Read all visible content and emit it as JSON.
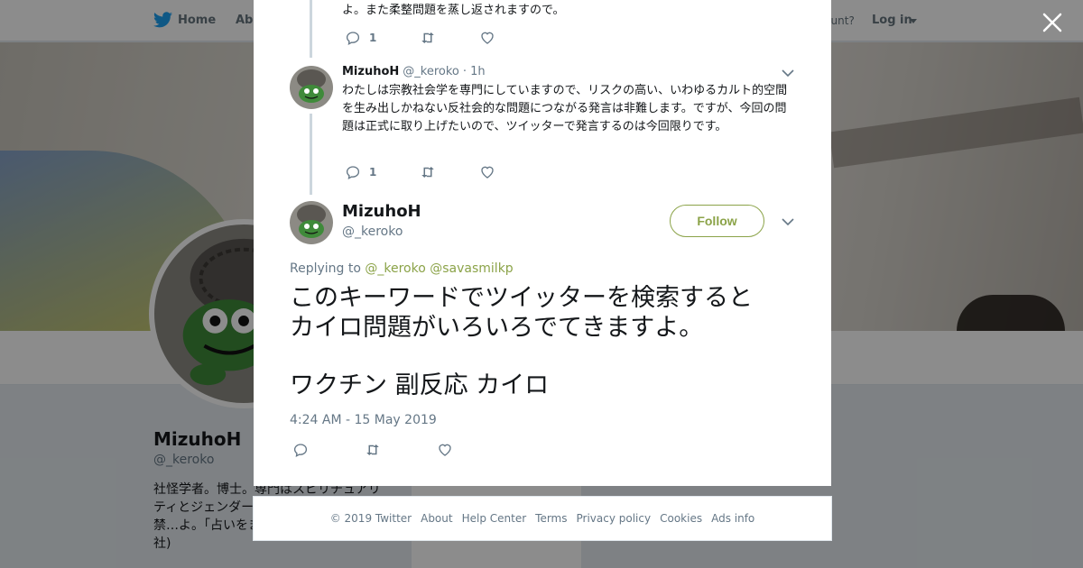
{
  "topbar": {
    "home_label": "Home",
    "about_label": "Abo",
    "account_prompt": "ccount?",
    "login_label": "Log in"
  },
  "profile": {
    "name": "MizuhoH",
    "handle": "@_keroko",
    "bio": "社怪学者。博士。専門はスピリチュアリティとジェンダー。…ています。 転載禁…よ。「占いをまとう少女たち」(青弓社)"
  },
  "thread": {
    "prev_fragment": "よ。また柔整問題を蒸し返されますので。",
    "prev_actions": {
      "reply_count": "1"
    },
    "reply": {
      "name": "MizuhoH",
      "handle": "@_keroko",
      "time": "· 1h",
      "text": "わたしは宗教社会学を専門にしていますので、リスクの高い、いわゆるカルト的空間を生み出しかねない反社会的な問題につながる発言は非難します。ですが、今回の問題は正式に取り上げたいので、ツイッターで発言するのは今回限りです。",
      "reply_count": "1"
    }
  },
  "main_tweet": {
    "name": "MizuhoH",
    "handle": "@_keroko",
    "follow_label": "Follow",
    "replying_prefix": "Replying to",
    "replying_mentions": "@_keroko @savasmilkp",
    "text_line1": "このキーワードでツイッターを検索すると",
    "text_line2": "カイロ問題がいろいろでてきますよ。",
    "text_line3": "ワクチン 副反応 カイロ",
    "timestamp": "4:24 AM - 15 May 2019"
  },
  "footer": {
    "copyright": "© 2019 Twitter",
    "about": "About",
    "help": "Help Center",
    "terms": "Terms",
    "privacy": "Privacy policy",
    "cookies": "Cookies",
    "ads": "Ads info"
  },
  "colors": {
    "accent": "#8ba348",
    "twitter_blue": "#1da1f2",
    "text_secondary": "#657786"
  }
}
